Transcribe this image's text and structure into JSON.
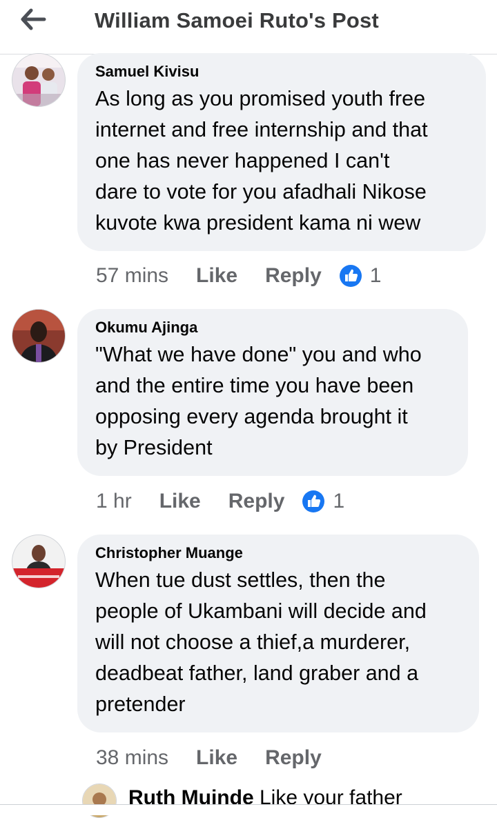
{
  "header": {
    "title": "William Samoei Ruto's Post",
    "back_icon": "arrow-left-icon"
  },
  "colors": {
    "bubble": "#f0f2f5",
    "like_blue": "#1877f2",
    "meta_gray": "#65676b"
  },
  "comments": [
    {
      "author": "Samuel Kivisu",
      "text_lines": [
        "As long as you promised youth free",
        "internet and free internship and that",
        "one has never happened I can't",
        "dare to vote for you afadhali Nikose",
        "kuvote kwa president kama ni wew"
      ],
      "time": "57 mins",
      "like_label": "Like",
      "reply_label": "Reply",
      "reaction_count": "1"
    },
    {
      "author": "Okumu Ajinga",
      "text_lines": [
        "\"What we have done\" you and who",
        "and the entire time you have been",
        "opposing every agenda brought it",
        "by President"
      ],
      "time": "1 hr",
      "like_label": "Like",
      "reply_label": "Reply",
      "reaction_count": "1"
    },
    {
      "author": "Christopher Muange",
      "text_lines": [
        "When tue dust settles, then the",
        "people of Ukambani will decide and",
        "will not choose a thief,a murderer,",
        "deadbeat father, land graber and a",
        "pretender"
      ],
      "time": "38 mins",
      "like_label": "Like",
      "reply_label": "Reply"
    }
  ],
  "reply_preview": {
    "author": "Ruth Muinde",
    "text": "Like your father"
  }
}
